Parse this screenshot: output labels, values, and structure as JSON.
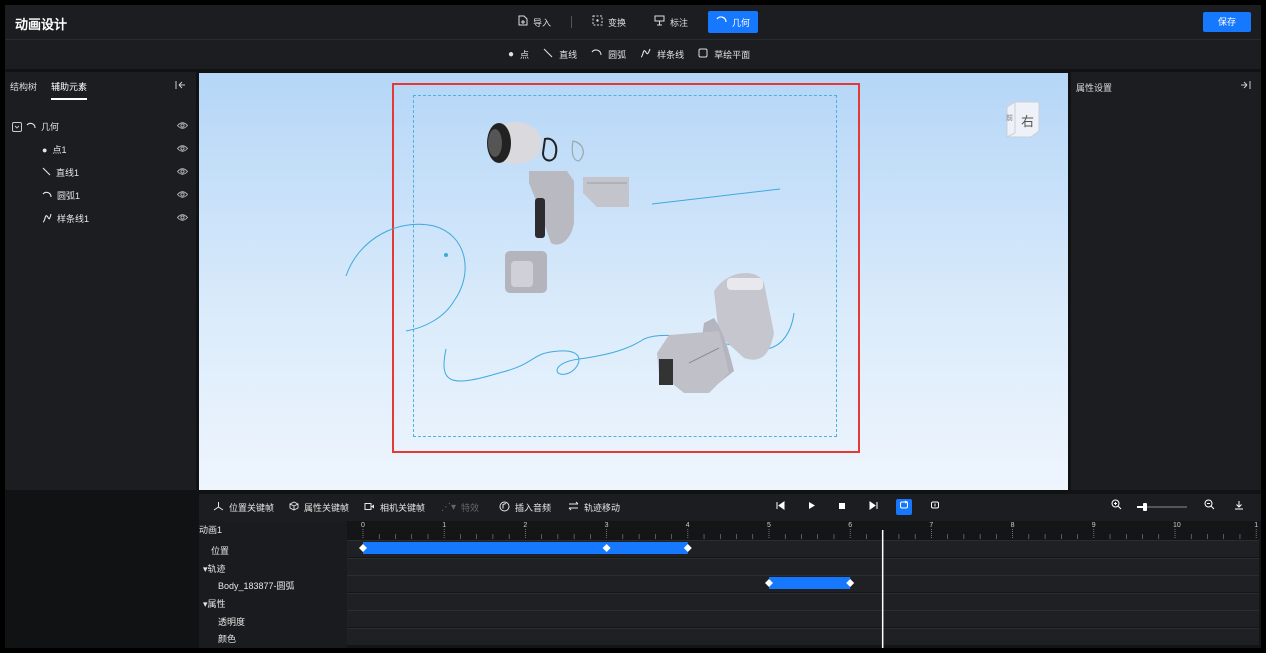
{
  "app": {
    "title": "动画设计",
    "save_label": "保存",
    "accent": "#1677ff"
  },
  "top_tabs": [
    {
      "label": "导入",
      "icon": "import-icon"
    },
    {
      "label": "变换",
      "icon": "transform-icon"
    },
    {
      "label": "标注",
      "icon": "annotation-icon"
    },
    {
      "label": "几何",
      "icon": "arc-icon",
      "active": true
    }
  ],
  "sub_tools": [
    {
      "label": "点",
      "icon": "dot-icon"
    },
    {
      "label": "直线",
      "icon": "line-icon"
    },
    {
      "label": "圆弧",
      "icon": "arc-icon"
    },
    {
      "label": "样条线",
      "icon": "spline-icon"
    },
    {
      "label": "草绘平面",
      "icon": "plane-icon"
    }
  ],
  "left_panel": {
    "tabs": [
      "结构树",
      "辅助元素"
    ],
    "active_tab": "辅助元素",
    "tree": {
      "root": "几何",
      "children": [
        "点1",
        "直线1",
        "圆弧1",
        "样条线1"
      ]
    }
  },
  "viewport": {
    "view_cube_label": "右",
    "view_cube_side": "前"
  },
  "right_panel": {
    "title": "属性设置"
  },
  "timeline": {
    "toolbar": [
      "位置关键帧",
      "属性关键帧",
      "相机关键帧",
      "特效",
      "插入音频",
      "轨迹移动"
    ],
    "ruler_ticks": [
      "0",
      "1",
      "2",
      "3",
      "4",
      "5",
      "6",
      "7",
      "8",
      "9",
      "10",
      "1"
    ],
    "animation_name": "动画1",
    "rows": [
      "位置",
      "▾轨迹",
      "Body_183877-圆弧",
      "▾属性",
      "透明度",
      "颜色"
    ],
    "playhead_time": 6.4,
    "position_keyframes": [
      0,
      3,
      4
    ],
    "trajectory_keyframes": [
      5,
      6
    ]
  }
}
